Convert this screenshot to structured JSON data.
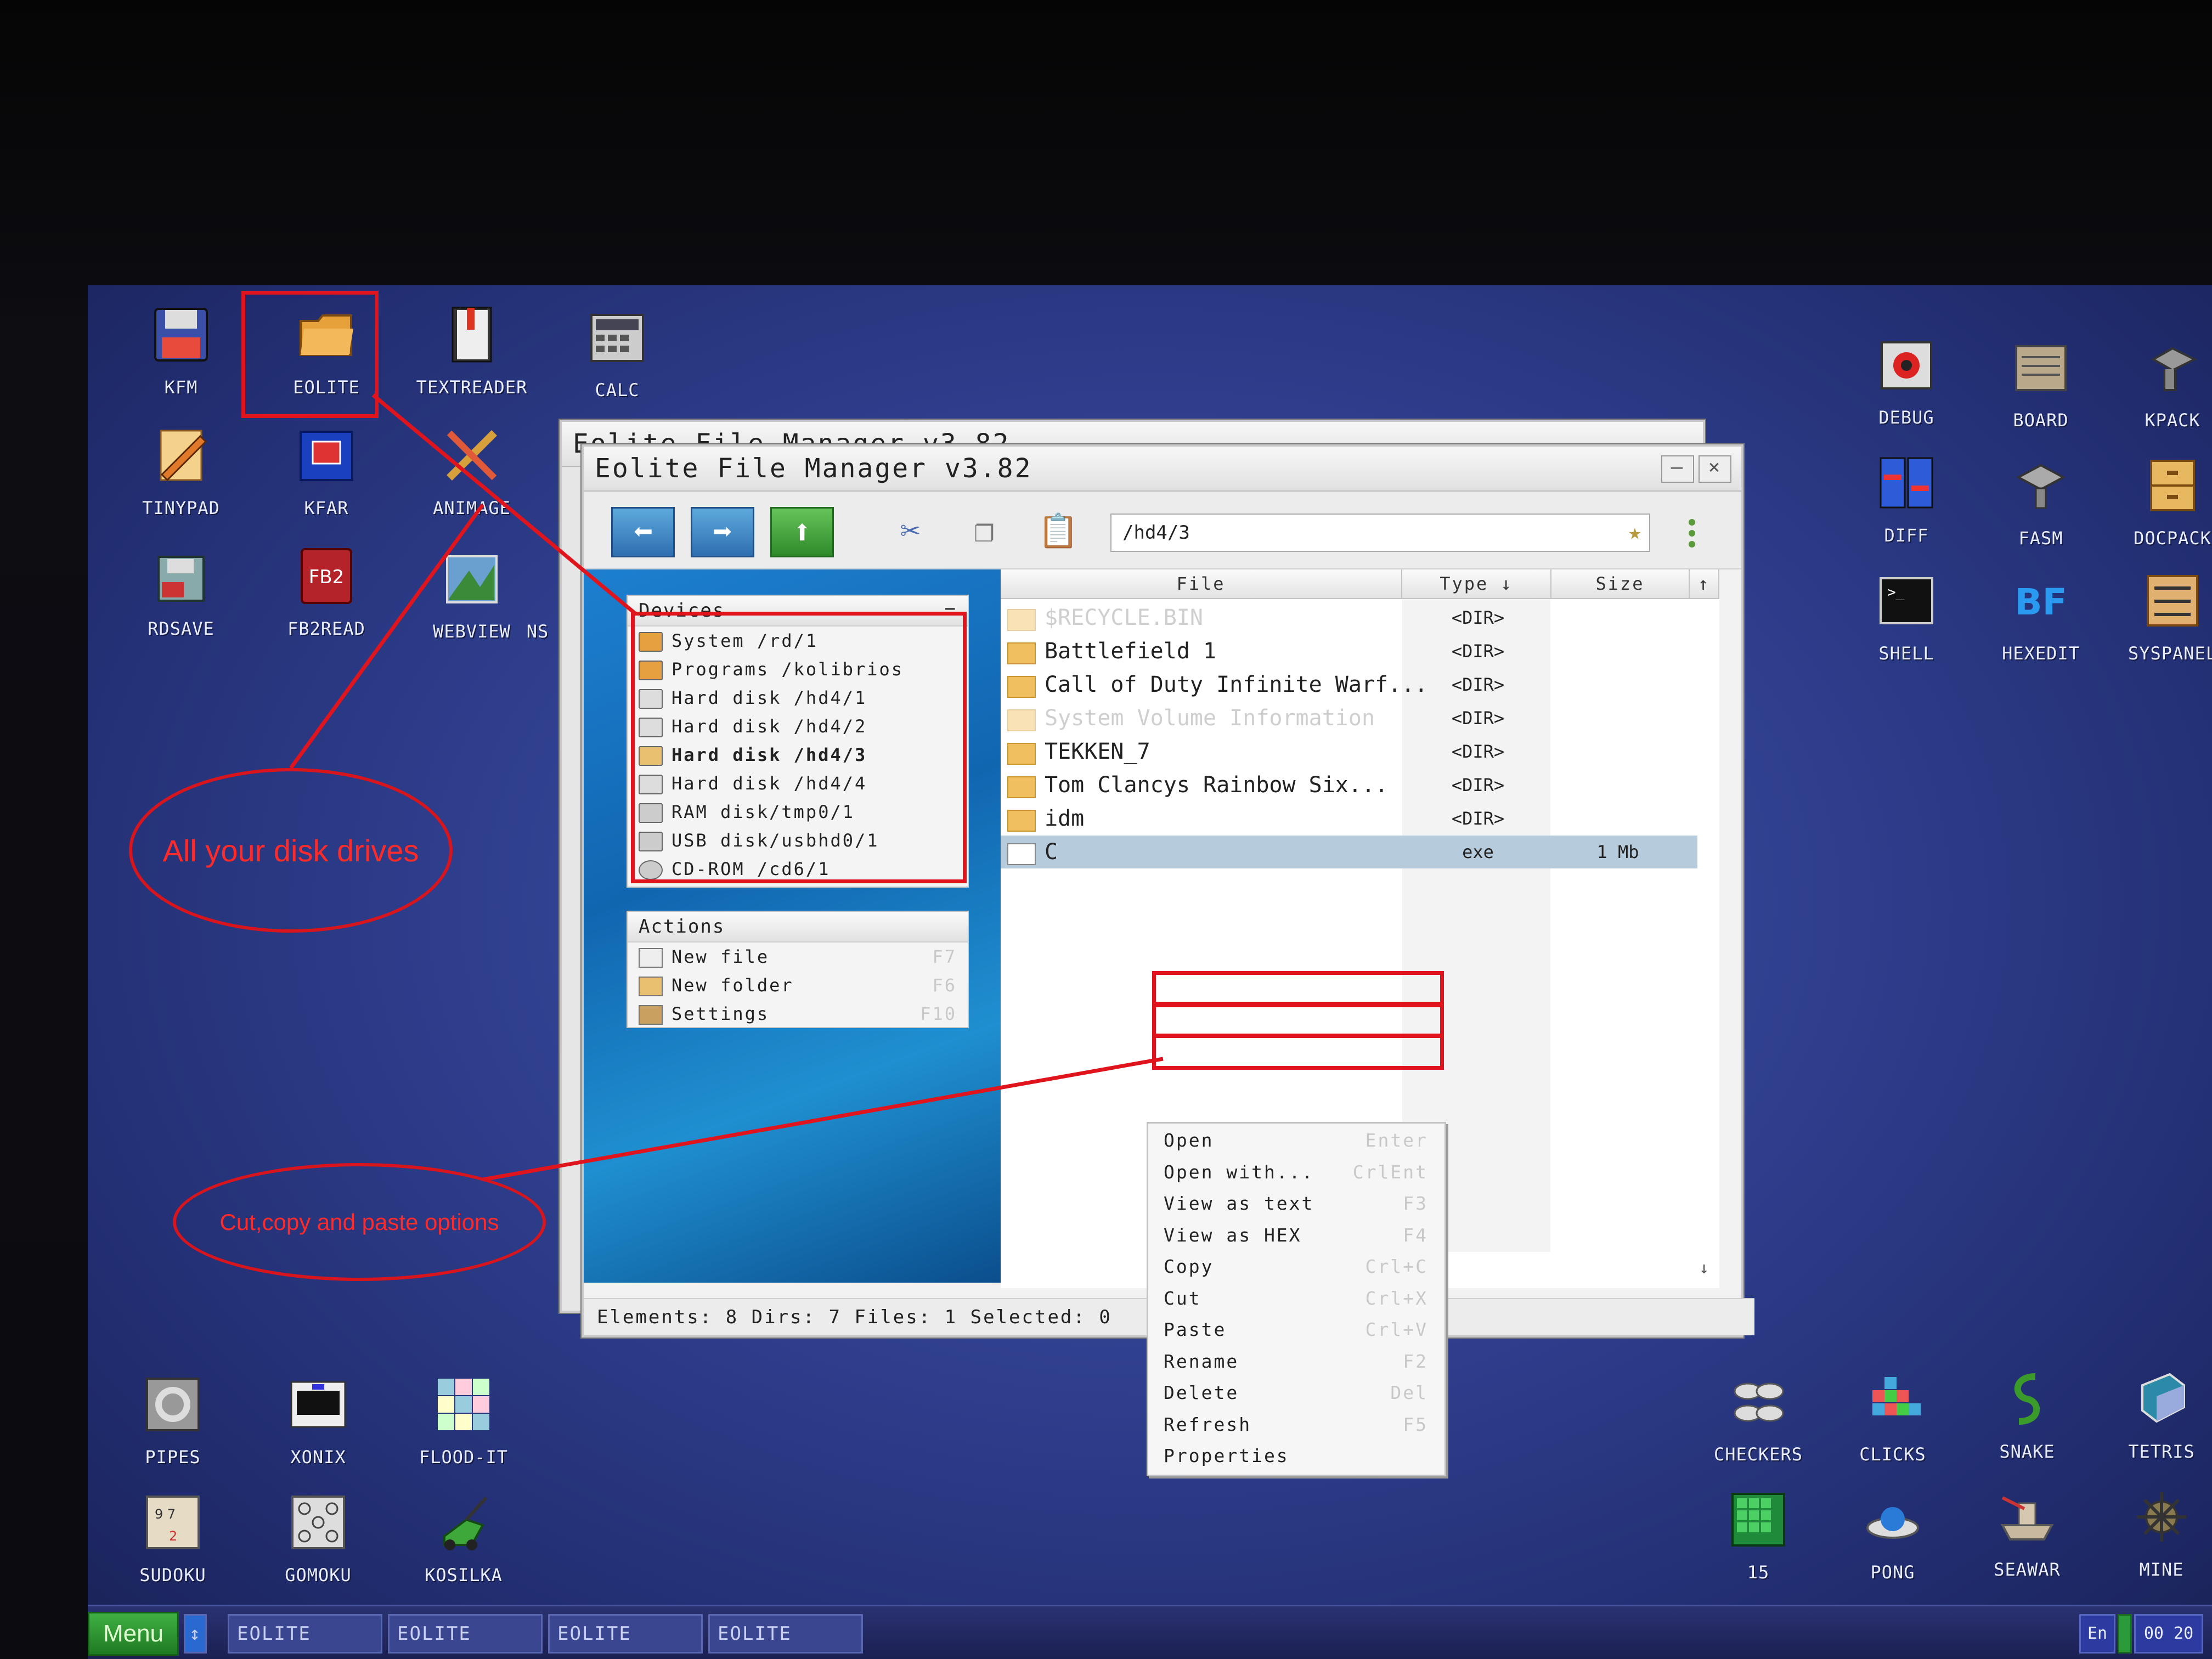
{
  "desktop_icons": {
    "kfm": {
      "label": "KFM",
      "icon": "floppy-icon"
    },
    "eolite": {
      "label": "EOLITE",
      "icon": "folder-icon"
    },
    "textreader": {
      "label": "TEXTREADER",
      "icon": "book-icon"
    },
    "calc": {
      "label": "CALC",
      "icon": "calculator-icon"
    },
    "tinypad": {
      "label": "TINYPAD",
      "icon": "pencil-icon"
    },
    "kfar": {
      "label": "KFAR",
      "icon": "archive-icon"
    },
    "animage": {
      "label": "ANIMAGE",
      "icon": "brush-icon"
    },
    "rdsave": {
      "label": "RDSAVE",
      "icon": "disk-save-icon"
    },
    "fb2read": {
      "label": "FB2READ",
      "icon": "fb2-icon"
    },
    "webview": {
      "label": "WEBVIEW",
      "icon": "globe-icon"
    },
    "ns": {
      "label": "NS"
    },
    "debug": {
      "label": "DEBUG",
      "icon": "bug-icon"
    },
    "board": {
      "label": "BOARD",
      "icon": "board-icon"
    },
    "kpack": {
      "label": "KPACK",
      "icon": "kpack-icon"
    },
    "diff": {
      "label": "DIFF",
      "icon": "diff-icon"
    },
    "fasm": {
      "label": "FASM",
      "icon": "fasm-icon"
    },
    "docpack": {
      "label": "DOCPACK",
      "icon": "drawer-icon"
    },
    "shell": {
      "label": "SHELL",
      "icon": "terminal-icon"
    },
    "hexedit": {
      "label": "HEXEDIT",
      "icon": "hex-icon"
    },
    "syspanel": {
      "label": "SYSPANEL",
      "icon": "sliders-icon"
    },
    "pipes": {
      "label": "PIPES",
      "icon": "pipes-icon"
    },
    "xonix": {
      "label": "XONIX",
      "icon": "xonix-icon"
    },
    "floodit": {
      "label": "FLOOD-IT",
      "icon": "flood-icon"
    },
    "sudoku": {
      "label": "SUDOKU",
      "icon": "sudoku-icon"
    },
    "gomoku": {
      "label": "GOMOKU",
      "icon": "gomoku-icon"
    },
    "kosilka": {
      "label": "KOSILKA",
      "icon": "mower-icon"
    },
    "checkers": {
      "label": "CHECKERS",
      "icon": "checkers-icon"
    },
    "clicks": {
      "label": "CLICKS",
      "icon": "clicks-icon"
    },
    "snake": {
      "label": "SNAKE",
      "icon": "snake-icon"
    },
    "tetris": {
      "label": "TETRIS",
      "icon": "tetris-icon"
    },
    "fifteen": {
      "label": "15",
      "icon": "fifteen-icon"
    },
    "pong": {
      "label": "PONG",
      "icon": "pong-icon"
    },
    "seawar": {
      "label": "SEAWAR",
      "icon": "seawar-icon"
    },
    "mine": {
      "label": "MINE",
      "icon": "mine-icon"
    }
  },
  "back_window": {
    "title": "Eolite File Manager v3.82"
  },
  "window": {
    "title": "Eolite File Manager v3.82",
    "minimize": "–",
    "close": "×",
    "path": "/hd4/3",
    "star": "★"
  },
  "devices": {
    "header": "Devices",
    "header_btn": "=",
    "items": [
      {
        "label": "System /rd/1",
        "icon": "system-drive-icon"
      },
      {
        "label": "Programs /kolibrios",
        "icon": "programs-drive-icon"
      },
      {
        "label": "Hard disk /hd4/1",
        "icon": "hard-disk-icon"
      },
      {
        "label": "Hard disk /hd4/2",
        "icon": "hard-disk-icon"
      },
      {
        "label": "Hard disk /hd4/3",
        "icon": "hard-disk-icon"
      },
      {
        "label": "Hard disk /hd4/4",
        "icon": "hard-disk-icon"
      },
      {
        "label": "RAM disk/tmp0/1",
        "icon": "ram-disk-icon"
      },
      {
        "label": "USB disk/usbhd0/1",
        "icon": "usb-disk-icon"
      },
      {
        "label": "CD-ROM /cd6/1",
        "icon": "cdrom-icon"
      }
    ]
  },
  "actions": {
    "header": "Actions",
    "items": [
      {
        "label": "New file",
        "key": "F7"
      },
      {
        "label": "New folder",
        "key": "F6"
      },
      {
        "label": "Settings",
        "key": "F10"
      }
    ]
  },
  "columns": {
    "file": "File",
    "type": "Type ↓",
    "size": "Size",
    "scroll_up": "↑",
    "scroll_down": "↓"
  },
  "files": [
    {
      "name": "$RECYCLE.BIN",
      "type": "<DIR>",
      "size": ""
    },
    {
      "name": "Battlefield 1",
      "type": "<DIR>",
      "size": ""
    },
    {
      "name": "Call of Duty Infinite Warf...",
      "type": "<DIR>",
      "size": ""
    },
    {
      "name": "System Volume Information",
      "type": "<DIR>",
      "size": ""
    },
    {
      "name": "TEKKEN_7",
      "type": "<DIR>",
      "size": ""
    },
    {
      "name": "Tom Clancys Rainbow Six...",
      "type": "<DIR>",
      "size": ""
    },
    {
      "name": "idm",
      "type": "<DIR>",
      "size": ""
    },
    {
      "name": "C",
      "type": "exe",
      "size": "1 Mb"
    }
  ],
  "context_menu": [
    {
      "label": "Open",
      "key": "Enter"
    },
    {
      "label": "Open with...",
      "key": "CrlEnt"
    },
    {
      "label": "View as text",
      "key": "F3"
    },
    {
      "label": "View as HEX",
      "key": "F4"
    },
    {
      "label": "Copy",
      "key": "Crl+C"
    },
    {
      "label": "Cut",
      "key": "Crl+X"
    },
    {
      "label": "Paste",
      "key": "Crl+V"
    },
    {
      "label": "Rename",
      "key": "F2"
    },
    {
      "label": "Delete",
      "key": "Del"
    },
    {
      "label": "Refresh",
      "key": "F5"
    },
    {
      "label": "Properties",
      "key": ""
    }
  ],
  "status": "Elements: 8   Dirs: 7   Files: 1    Selected: 0",
  "annotations": {
    "drives": "All your disk drives",
    "clipboard": "Cut,copy and paste options"
  },
  "taskbar": {
    "menu": "Menu",
    "switcher": "↕",
    "tasks": [
      "EOLITE",
      "EOLITE",
      "EOLITE",
      "EOLITE"
    ],
    "lang": "En",
    "clock": "00 20"
  },
  "colors": {
    "annotation_red": "#e0141c",
    "desktop_blue": "#2f3f8e"
  }
}
